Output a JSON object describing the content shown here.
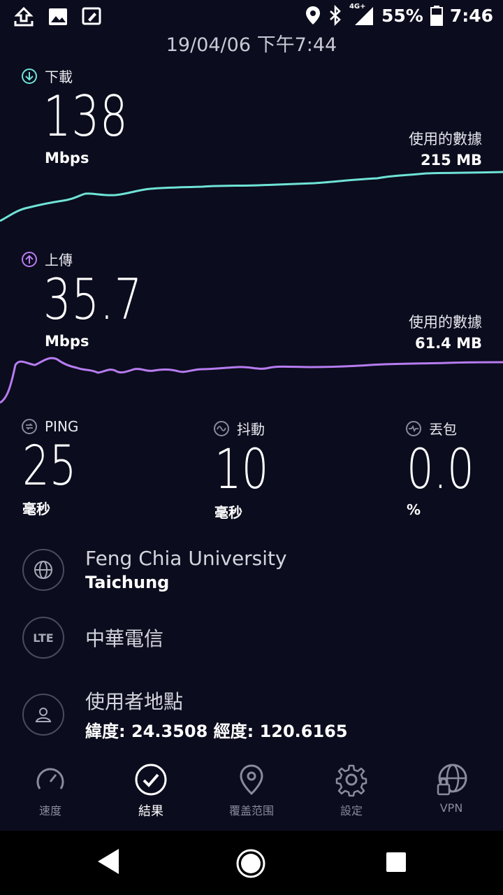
{
  "statusbar": {
    "network": "4G+",
    "battery_percent": "55%",
    "time": "7:46"
  },
  "datetime": "19/04/06 下午7:44",
  "download": {
    "label": "下載",
    "value": "138",
    "unit": "Mbps",
    "usage_label": "使用的數據",
    "usage_value": "215 MB",
    "color": "#6fe3d7"
  },
  "upload": {
    "label": "上傳",
    "value": "35.7",
    "unit": "Mbps",
    "usage_label": "使用的數據",
    "usage_value": "61.4 MB",
    "color": "#b77cf0"
  },
  "metrics": {
    "ping": {
      "label": "PING",
      "value": "25",
      "unit": "毫秒"
    },
    "jitter": {
      "label": "抖動",
      "value": "10",
      "unit": "毫秒"
    },
    "loss": {
      "label": "丟包",
      "value": "0.0",
      "unit": "%"
    }
  },
  "server": {
    "name": "Feng Chia University",
    "city": "Taichung"
  },
  "provider": {
    "badge": "LTE",
    "name": "中華電信"
  },
  "location": {
    "title": "使用者地點",
    "coords": "緯度: 24.3508 經度: 120.6165"
  },
  "tabs": {
    "speed": "速度",
    "results": "結果",
    "coverage": "覆盖范围",
    "settings": "設定",
    "vpn": "VPN"
  }
}
